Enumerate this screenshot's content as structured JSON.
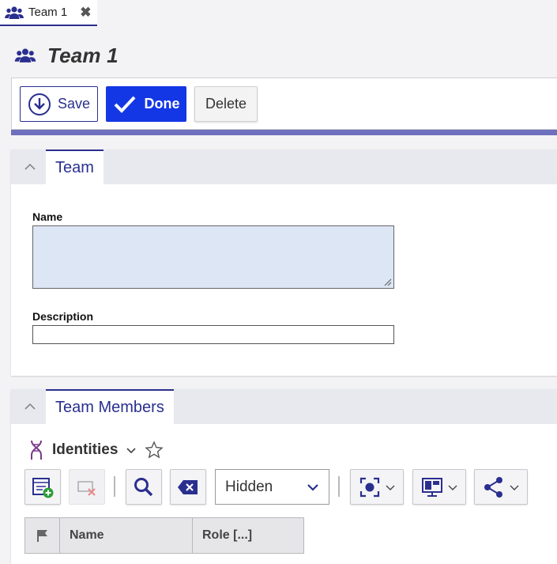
{
  "tab": {
    "label": "Team 1",
    "close_glyph": "✖"
  },
  "header": {
    "title": "Team 1",
    "icon": "team-icon"
  },
  "toolbar": {
    "save_label": "Save",
    "done_label": "Done",
    "delete_label": "Delete"
  },
  "team_panel": {
    "tab_label": "Team",
    "name_label": "Name",
    "name_value": "",
    "description_label": "Description",
    "description_value": ""
  },
  "members_panel": {
    "tab_label": "Team Members",
    "list_title": "Identities",
    "visibility_select": "Hidden",
    "columns": [
      "Name",
      "Role [...]"
    ]
  },
  "colors": {
    "accent": "#2a2f8f",
    "primary_button": "#1437e6",
    "input_bg": "#dde6f5"
  }
}
